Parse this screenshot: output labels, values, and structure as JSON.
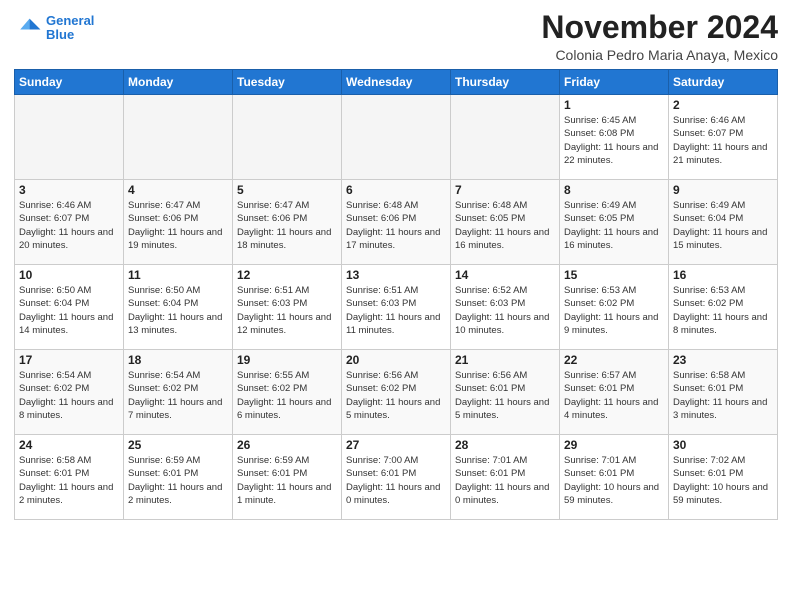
{
  "logo": {
    "line1": "General",
    "line2": "Blue"
  },
  "title": "November 2024",
  "subtitle": "Colonia Pedro Maria Anaya, Mexico",
  "weekdays": [
    "Sunday",
    "Monday",
    "Tuesday",
    "Wednesday",
    "Thursday",
    "Friday",
    "Saturday"
  ],
  "weeks": [
    [
      {
        "day": "",
        "empty": true
      },
      {
        "day": "",
        "empty": true
      },
      {
        "day": "",
        "empty": true
      },
      {
        "day": "",
        "empty": true
      },
      {
        "day": "",
        "empty": true
      },
      {
        "day": "1",
        "sunrise": "6:45 AM",
        "sunset": "6:08 PM",
        "daylight": "11 hours and 22 minutes."
      },
      {
        "day": "2",
        "sunrise": "6:46 AM",
        "sunset": "6:07 PM",
        "daylight": "11 hours and 21 minutes."
      }
    ],
    [
      {
        "day": "3",
        "sunrise": "6:46 AM",
        "sunset": "6:07 PM",
        "daylight": "11 hours and 20 minutes."
      },
      {
        "day": "4",
        "sunrise": "6:47 AM",
        "sunset": "6:06 PM",
        "daylight": "11 hours and 19 minutes."
      },
      {
        "day": "5",
        "sunrise": "6:47 AM",
        "sunset": "6:06 PM",
        "daylight": "11 hours and 18 minutes."
      },
      {
        "day": "6",
        "sunrise": "6:48 AM",
        "sunset": "6:06 PM",
        "daylight": "11 hours and 17 minutes."
      },
      {
        "day": "7",
        "sunrise": "6:48 AM",
        "sunset": "6:05 PM",
        "daylight": "11 hours and 16 minutes."
      },
      {
        "day": "8",
        "sunrise": "6:49 AM",
        "sunset": "6:05 PM",
        "daylight": "11 hours and 16 minutes."
      },
      {
        "day": "9",
        "sunrise": "6:49 AM",
        "sunset": "6:04 PM",
        "daylight": "11 hours and 15 minutes."
      }
    ],
    [
      {
        "day": "10",
        "sunrise": "6:50 AM",
        "sunset": "6:04 PM",
        "daylight": "11 hours and 14 minutes."
      },
      {
        "day": "11",
        "sunrise": "6:50 AM",
        "sunset": "6:04 PM",
        "daylight": "11 hours and 13 minutes."
      },
      {
        "day": "12",
        "sunrise": "6:51 AM",
        "sunset": "6:03 PM",
        "daylight": "11 hours and 12 minutes."
      },
      {
        "day": "13",
        "sunrise": "6:51 AM",
        "sunset": "6:03 PM",
        "daylight": "11 hours and 11 minutes."
      },
      {
        "day": "14",
        "sunrise": "6:52 AM",
        "sunset": "6:03 PM",
        "daylight": "11 hours and 10 minutes."
      },
      {
        "day": "15",
        "sunrise": "6:53 AM",
        "sunset": "6:02 PM",
        "daylight": "11 hours and 9 minutes."
      },
      {
        "day": "16",
        "sunrise": "6:53 AM",
        "sunset": "6:02 PM",
        "daylight": "11 hours and 8 minutes."
      }
    ],
    [
      {
        "day": "17",
        "sunrise": "6:54 AM",
        "sunset": "6:02 PM",
        "daylight": "11 hours and 8 minutes."
      },
      {
        "day": "18",
        "sunrise": "6:54 AM",
        "sunset": "6:02 PM",
        "daylight": "11 hours and 7 minutes."
      },
      {
        "day": "19",
        "sunrise": "6:55 AM",
        "sunset": "6:02 PM",
        "daylight": "11 hours and 6 minutes."
      },
      {
        "day": "20",
        "sunrise": "6:56 AM",
        "sunset": "6:02 PM",
        "daylight": "11 hours and 5 minutes."
      },
      {
        "day": "21",
        "sunrise": "6:56 AM",
        "sunset": "6:01 PM",
        "daylight": "11 hours and 5 minutes."
      },
      {
        "day": "22",
        "sunrise": "6:57 AM",
        "sunset": "6:01 PM",
        "daylight": "11 hours and 4 minutes."
      },
      {
        "day": "23",
        "sunrise": "6:58 AM",
        "sunset": "6:01 PM",
        "daylight": "11 hours and 3 minutes."
      }
    ],
    [
      {
        "day": "24",
        "sunrise": "6:58 AM",
        "sunset": "6:01 PM",
        "daylight": "11 hours and 2 minutes."
      },
      {
        "day": "25",
        "sunrise": "6:59 AM",
        "sunset": "6:01 PM",
        "daylight": "11 hours and 2 minutes."
      },
      {
        "day": "26",
        "sunrise": "6:59 AM",
        "sunset": "6:01 PM",
        "daylight": "11 hours and 1 minute."
      },
      {
        "day": "27",
        "sunrise": "7:00 AM",
        "sunset": "6:01 PM",
        "daylight": "11 hours and 0 minutes."
      },
      {
        "day": "28",
        "sunrise": "7:01 AM",
        "sunset": "6:01 PM",
        "daylight": "11 hours and 0 minutes."
      },
      {
        "day": "29",
        "sunrise": "7:01 AM",
        "sunset": "6:01 PM",
        "daylight": "10 hours and 59 minutes."
      },
      {
        "day": "30",
        "sunrise": "7:02 AM",
        "sunset": "6:01 PM",
        "daylight": "10 hours and 59 minutes."
      }
    ]
  ]
}
